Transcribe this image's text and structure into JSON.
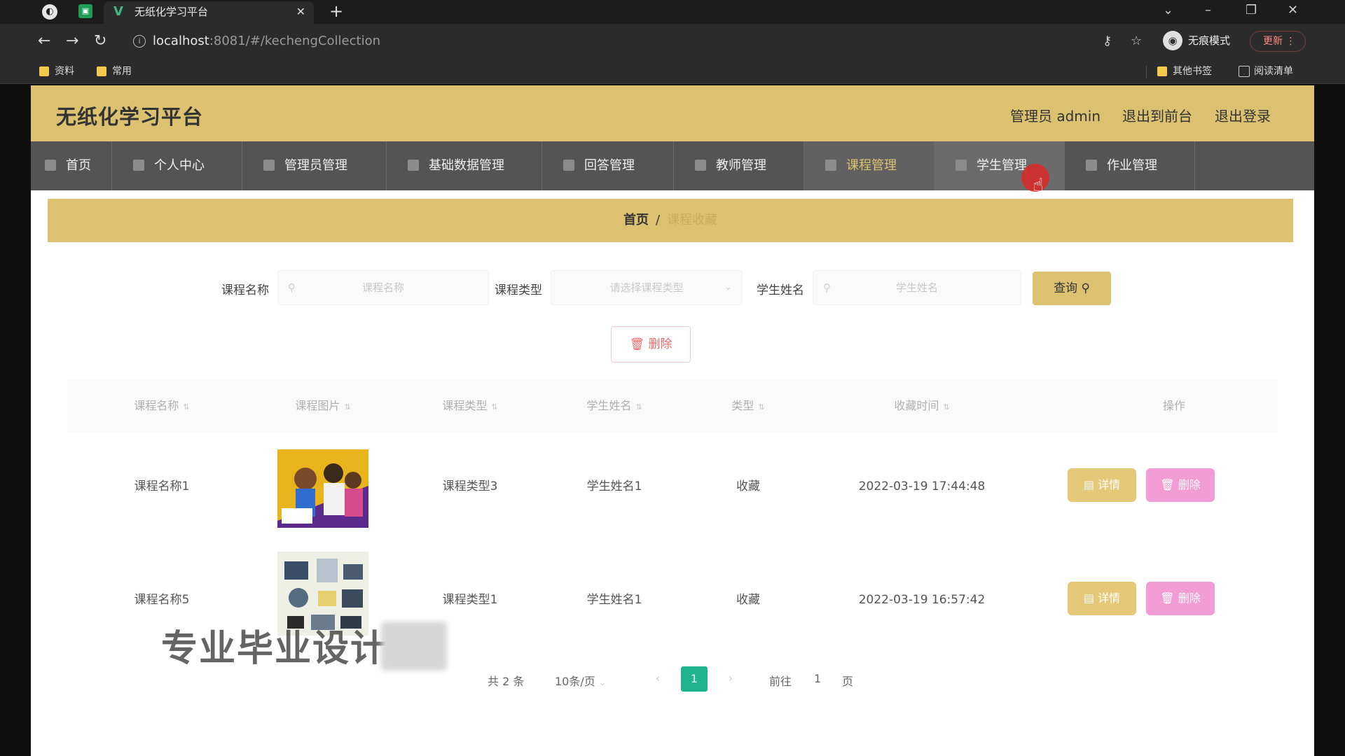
{
  "browser": {
    "tab_title": "无纸化学习平台",
    "url_host": "localhost",
    "url_path": ":8081/#/kechengCollection",
    "incognito_label": "无痕模式",
    "update_label": "更新",
    "bookmarks": [
      "资料",
      "常用"
    ],
    "bookmarks_right": [
      "其他书签",
      "阅读清单"
    ]
  },
  "site": {
    "title": "无纸化学习平台",
    "user_label": "管理员 admin",
    "to_front": "退出到前台",
    "logout": "退出登录"
  },
  "nav": {
    "items": [
      "首页",
      "个人中心",
      "管理员管理",
      "基础数据管理",
      "回答管理",
      "教师管理",
      "课程管理",
      "学生管理",
      "作业管理"
    ],
    "active": "课程管理",
    "hover": "学生管理"
  },
  "breadcrumb": {
    "home": "首页",
    "sep": "/",
    "current": "课程收藏"
  },
  "search": {
    "course_name_label": "课程名称",
    "course_name_placeholder": "课程名称",
    "course_type_label": "课程类型",
    "course_type_placeholder": "请选择课程类型",
    "student_name_label": "学生姓名",
    "student_name_placeholder": "学生姓名",
    "query_label": "查询"
  },
  "toolbar": {
    "delete_label": "删除"
  },
  "table": {
    "headers": [
      "课程名称",
      "课程图片",
      "课程类型",
      "学生姓名",
      "类型",
      "收藏时间",
      "操作"
    ],
    "rows": [
      {
        "name": "课程名称1",
        "type": "课程类型3",
        "student": "学生姓名1",
        "kind": "收藏",
        "time": "2022-03-19 17:44:48"
      },
      {
        "name": "课程名称5",
        "type": "课程类型1",
        "student": "学生姓名1",
        "kind": "收藏",
        "time": "2022-03-19 16:57:42"
      }
    ],
    "detail_label": "详情",
    "delete_label": "删除"
  },
  "pagination": {
    "total": "共 2 条",
    "page_size": "10条/页",
    "current": "1",
    "goto_prefix": "前往",
    "goto_value": "1",
    "goto_suffix": "页"
  },
  "watermark": "专业毕业设计",
  "colors": {
    "header": "#dcc170",
    "nav": "#545454",
    "detail": "#e4c877",
    "delete": "#f29bd4",
    "page_active": "#1fb48d"
  }
}
